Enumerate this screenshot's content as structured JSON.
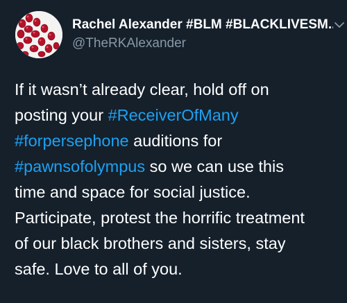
{
  "author": {
    "display_name": "Rachel Alexander #BLM #BLACKLIVESM...",
    "handle": "@TheRKAlexander",
    "avatar_icon": "pomegranate-seeds-avatar"
  },
  "menu_icon": "chevron-down-icon",
  "tweet": {
    "lines": [
      [
        {
          "t": "If it wasn’t already clear, hold off on"
        }
      ],
      [
        {
          "t": "posting your "
        },
        {
          "t": "#ReceiverOfMany",
          "tag": true
        }
      ],
      [
        {
          "t": "#forpersephone",
          "tag": true
        },
        {
          "t": " auditions for"
        }
      ],
      [
        {
          "t": "#pawnsofolympus",
          "tag": true
        },
        {
          "t": " so we can use this"
        }
      ],
      [
        {
          "t": "time and space for social justice."
        }
      ],
      [
        {
          "t": "Participate, protest the horrific treatment"
        }
      ],
      [
        {
          "t": "of our black brothers and sisters, stay"
        }
      ],
      [
        {
          "t": "safe. Love to all of you."
        }
      ]
    ]
  },
  "colors": {
    "background": "#15202b",
    "text": "#ffffff",
    "secondary_text": "#8899a6",
    "hashtag": "#1da1f2"
  }
}
